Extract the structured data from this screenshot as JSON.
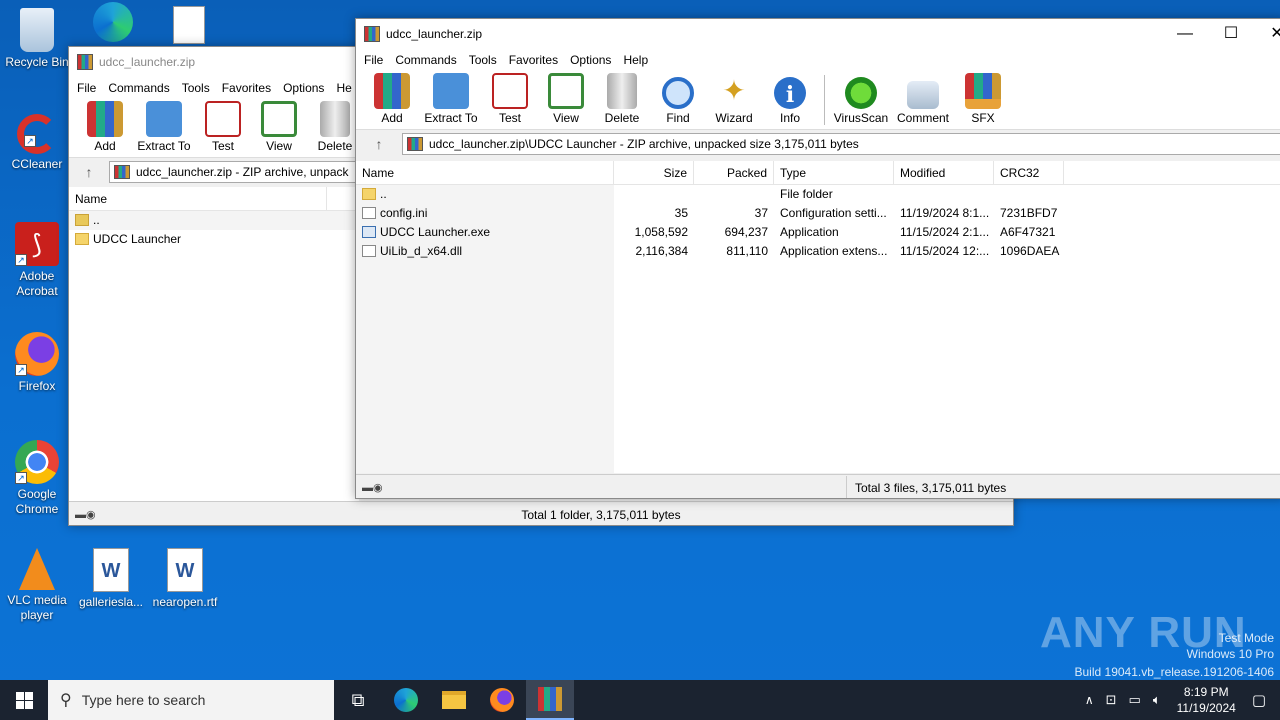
{
  "desktop": {
    "icons": [
      {
        "label": "Recycle Bin"
      },
      {
        "label": "CCleaner"
      },
      {
        "label": "Adobe Acrobat"
      },
      {
        "label": "Firefox"
      },
      {
        "label": "Google Chrome"
      },
      {
        "label": "VLC media player"
      },
      {
        "label": "gallerieslа..."
      },
      {
        "label": "nearopen.rtf"
      }
    ],
    "watermark": {
      "line1": "Test Mode",
      "line2": "Windows 10 Pro",
      "line3": "Build 19041.vb_release.191206-1406"
    },
    "brand": "ANY RUN"
  },
  "back_window": {
    "title": "udcc_launcher.zip",
    "menu": [
      "File",
      "Commands",
      "Tools",
      "Favorites",
      "Options",
      "He"
    ],
    "toolbar": [
      "Add",
      "Extract To",
      "Test",
      "View",
      "Delete"
    ],
    "path": "udcc_launcher.zip - ZIP archive, unpack",
    "columns": [
      "Name"
    ],
    "rows": [
      {
        "name": ".."
      },
      {
        "name": "UDCC Launcher"
      }
    ],
    "status": "Total 1 folder, 3,175,011 bytes"
  },
  "front_window": {
    "title": "udcc_launcher.zip",
    "menu": [
      "File",
      "Commands",
      "Tools",
      "Favorites",
      "Options",
      "Help"
    ],
    "toolbar": [
      "Add",
      "Extract To",
      "Test",
      "View",
      "Delete",
      "Find",
      "Wizard",
      "Info",
      "VirusScan",
      "Comment",
      "SFX"
    ],
    "path": "udcc_launcher.zip\\UDCC Launcher - ZIP archive, unpacked size 3,175,011 bytes",
    "columns": [
      "Name",
      "Size",
      "Packed",
      "Type",
      "Modified",
      "CRC32"
    ],
    "rows": [
      {
        "name": "..",
        "size": "",
        "packed": "",
        "type": "File folder",
        "modified": "",
        "crc": ""
      },
      {
        "name": "config.ini",
        "size": "35",
        "packed": "37",
        "type": "Configuration setti...",
        "modified": "11/19/2024 8:1...",
        "crc": "7231BFD7"
      },
      {
        "name": "UDCC Launcher.exe",
        "size": "1,058,592",
        "packed": "694,237",
        "type": "Application",
        "modified": "11/15/2024 2:1...",
        "crc": "A6F47321"
      },
      {
        "name": "UiLib_d_x64.dll",
        "size": "2,116,384",
        "packed": "811,110",
        "type": "Application extens...",
        "modified": "11/15/2024 12:...",
        "crc": "1096DAEA"
      }
    ],
    "status": "Total 3 files, 3,175,011 bytes"
  },
  "taskbar": {
    "search_placeholder": "Type here to search",
    "time": "8:19 PM",
    "date": "11/19/2024"
  }
}
